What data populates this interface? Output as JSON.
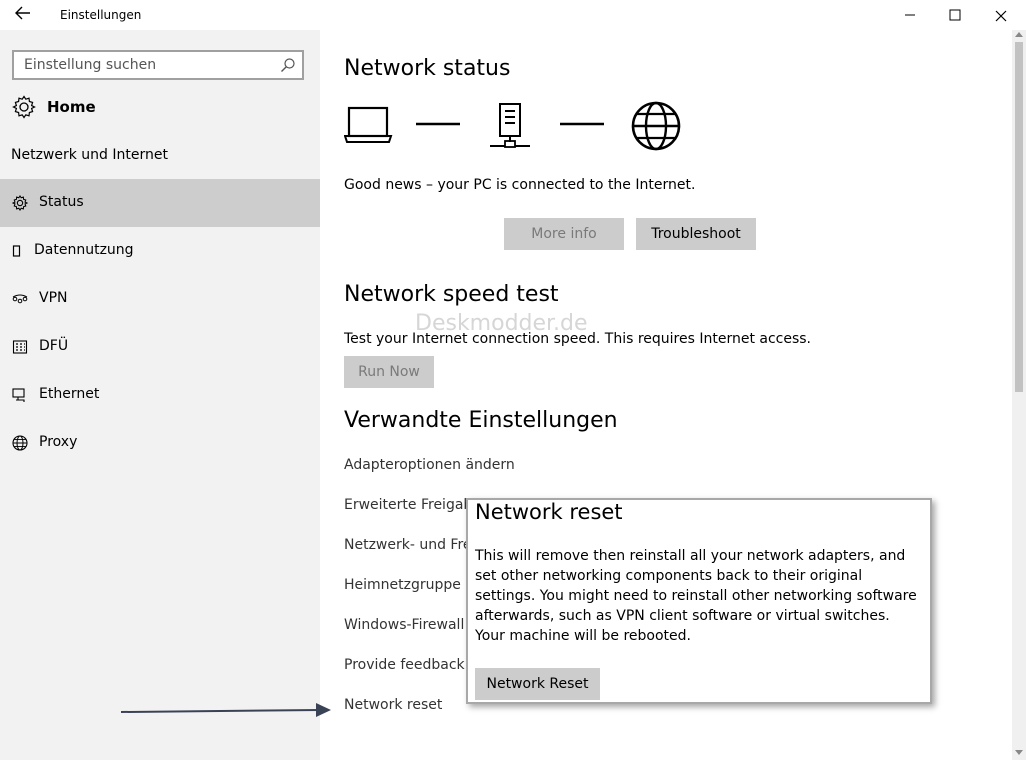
{
  "window": {
    "title": "Einstellungen",
    "back_icon": "back-arrow-icon",
    "minimize_glyph": "—",
    "maximize_glyph": "☐",
    "close_glyph": "✕"
  },
  "sidebar": {
    "search_placeholder": "Einstellung suchen",
    "home_label": "Home",
    "section_label": "Netzwerk und Internet",
    "items": [
      {
        "label": "Status",
        "icon": "gear-icon",
        "active": true
      },
      {
        "label": "Datennutzung",
        "icon": "data-usage-icon",
        "active": false
      },
      {
        "label": "VPN",
        "icon": "vpn-icon",
        "active": false
      },
      {
        "label": "DFÜ",
        "icon": "dialup-icon",
        "active": false
      },
      {
        "label": "Ethernet",
        "icon": "ethernet-icon",
        "active": false
      },
      {
        "label": "Proxy",
        "icon": "globe-icon",
        "active": false
      }
    ]
  },
  "main": {
    "status_heading": "Network status",
    "status_text": "Good news – your PC is connected to the Internet.",
    "more_info_label": "More info",
    "troubleshoot_label": "Troubleshoot",
    "speed_heading": "Network speed test",
    "speed_text": "Test your Internet connection speed. This requires Internet access.",
    "run_now_label": "Run Now",
    "related_heading": "Verwandte Einstellungen",
    "links": [
      "Adapteroptionen ändern",
      "Erweiterte Freigabe",
      "Netzwerk- und Fre",
      "Heimnetzgruppe",
      "Windows-Firewall",
      "Provide feedback a",
      "Network reset"
    ]
  },
  "watermark": "Deskmodder.de",
  "popup": {
    "title": "Network reset",
    "body": "This will remove then reinstall all your network adapters, and set other networking components back to their original settings. You might need to reinstall other networking software afterwards, such as VPN client software or virtual switches. Your machine will be rebooted.",
    "button_label": "Network Reset"
  },
  "colors": {
    "sidebar_bg": "#f2f2f2",
    "active_item_bg": "#cdcdcd",
    "button_bg": "#cccccc",
    "arrow": "#3a4256"
  }
}
